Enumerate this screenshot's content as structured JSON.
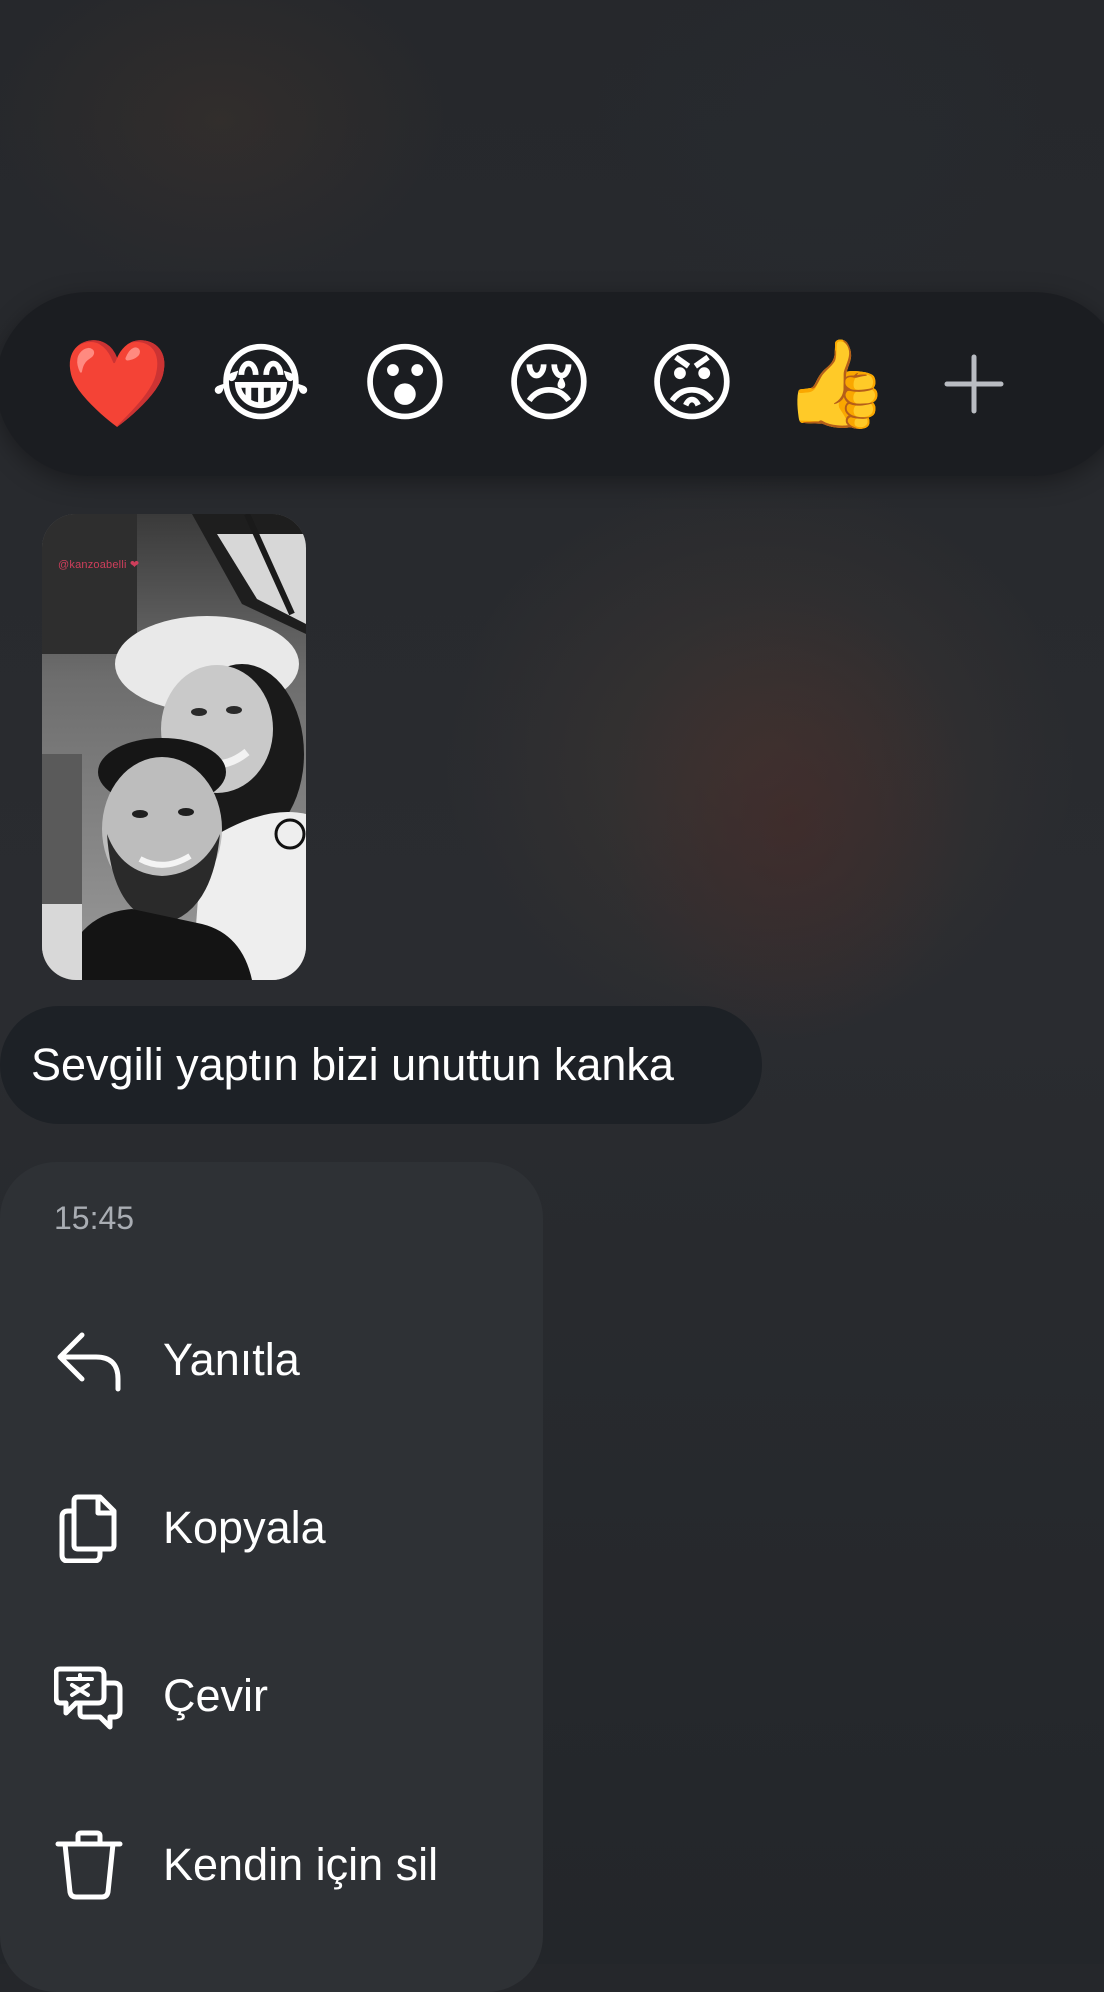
{
  "reactions": [
    {
      "emoji": "❤️",
      "name": "heart"
    },
    {
      "emoji": "😂",
      "name": "tears-of-joy"
    },
    {
      "emoji": "😮",
      "name": "surprised"
    },
    {
      "emoji": "😢",
      "name": "crying"
    },
    {
      "emoji": "😡",
      "name": "angry"
    },
    {
      "emoji": "👍",
      "name": "thumbs-up"
    }
  ],
  "reaction_more_icon": "plus-icon",
  "story": {
    "tag": "@kanzoabelli ❤"
  },
  "message": {
    "text": "Sevgili yaptın bizi unuttun kanka"
  },
  "menu": {
    "time": "15:45",
    "items": [
      {
        "label": "Yanıtla",
        "icon": "reply-icon"
      },
      {
        "label": "Kopyala",
        "icon": "copy-icon"
      },
      {
        "label": "Çevir",
        "icon": "translate-icon"
      },
      {
        "label": "Kendin için sil",
        "icon": "trash-icon"
      }
    ]
  },
  "colors": {
    "background": "#25272b",
    "reaction_bar": "#1b1d21",
    "bubble": "#1d2126",
    "menu": "#2e3135",
    "secondary_text": "#a9adb3"
  }
}
